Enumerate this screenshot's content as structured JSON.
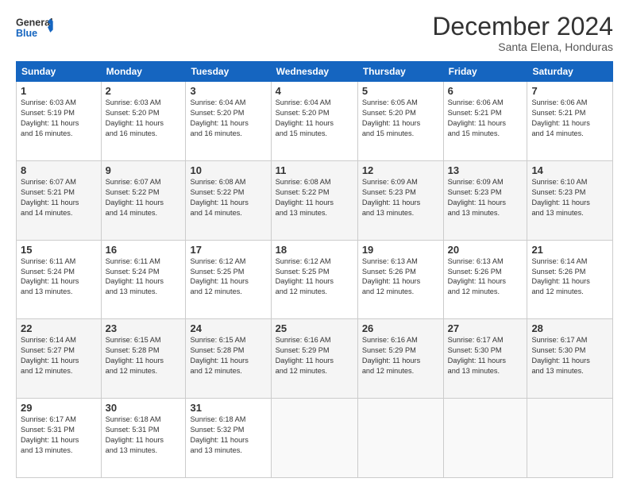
{
  "logo": {
    "line1": "General",
    "line2": "Blue"
  },
  "header": {
    "month_year": "December 2024",
    "location": "Santa Elena, Honduras"
  },
  "weekdays": [
    "Sunday",
    "Monday",
    "Tuesday",
    "Wednesday",
    "Thursday",
    "Friday",
    "Saturday"
  ],
  "weeks": [
    [
      {
        "day": "1",
        "sunrise": "6:03 AM",
        "sunset": "5:19 PM",
        "daylight": "11 hours and 16 minutes."
      },
      {
        "day": "2",
        "sunrise": "6:03 AM",
        "sunset": "5:20 PM",
        "daylight": "11 hours and 16 minutes."
      },
      {
        "day": "3",
        "sunrise": "6:04 AM",
        "sunset": "5:20 PM",
        "daylight": "11 hours and 16 minutes."
      },
      {
        "day": "4",
        "sunrise": "6:04 AM",
        "sunset": "5:20 PM",
        "daylight": "11 hours and 15 minutes."
      },
      {
        "day": "5",
        "sunrise": "6:05 AM",
        "sunset": "5:20 PM",
        "daylight": "11 hours and 15 minutes."
      },
      {
        "day": "6",
        "sunrise": "6:06 AM",
        "sunset": "5:21 PM",
        "daylight": "11 hours and 15 minutes."
      },
      {
        "day": "7",
        "sunrise": "6:06 AM",
        "sunset": "5:21 PM",
        "daylight": "11 hours and 14 minutes."
      }
    ],
    [
      {
        "day": "8",
        "sunrise": "6:07 AM",
        "sunset": "5:21 PM",
        "daylight": "11 hours and 14 minutes."
      },
      {
        "day": "9",
        "sunrise": "6:07 AM",
        "sunset": "5:22 PM",
        "daylight": "11 hours and 14 minutes."
      },
      {
        "day": "10",
        "sunrise": "6:08 AM",
        "sunset": "5:22 PM",
        "daylight": "11 hours and 14 minutes."
      },
      {
        "day": "11",
        "sunrise": "6:08 AM",
        "sunset": "5:22 PM",
        "daylight": "11 hours and 13 minutes."
      },
      {
        "day": "12",
        "sunrise": "6:09 AM",
        "sunset": "5:23 PM",
        "daylight": "11 hours and 13 minutes."
      },
      {
        "day": "13",
        "sunrise": "6:09 AM",
        "sunset": "5:23 PM",
        "daylight": "11 hours and 13 minutes."
      },
      {
        "day": "14",
        "sunrise": "6:10 AM",
        "sunset": "5:23 PM",
        "daylight": "11 hours and 13 minutes."
      }
    ],
    [
      {
        "day": "15",
        "sunrise": "6:11 AM",
        "sunset": "5:24 PM",
        "daylight": "11 hours and 13 minutes."
      },
      {
        "day": "16",
        "sunrise": "6:11 AM",
        "sunset": "5:24 PM",
        "daylight": "11 hours and 13 minutes."
      },
      {
        "day": "17",
        "sunrise": "6:12 AM",
        "sunset": "5:25 PM",
        "daylight": "11 hours and 12 minutes."
      },
      {
        "day": "18",
        "sunrise": "6:12 AM",
        "sunset": "5:25 PM",
        "daylight": "11 hours and 12 minutes."
      },
      {
        "day": "19",
        "sunrise": "6:13 AM",
        "sunset": "5:26 PM",
        "daylight": "11 hours and 12 minutes."
      },
      {
        "day": "20",
        "sunrise": "6:13 AM",
        "sunset": "5:26 PM",
        "daylight": "11 hours and 12 minutes."
      },
      {
        "day": "21",
        "sunrise": "6:14 AM",
        "sunset": "5:26 PM",
        "daylight": "11 hours and 12 minutes."
      }
    ],
    [
      {
        "day": "22",
        "sunrise": "6:14 AM",
        "sunset": "5:27 PM",
        "daylight": "11 hours and 12 minutes."
      },
      {
        "day": "23",
        "sunrise": "6:15 AM",
        "sunset": "5:28 PM",
        "daylight": "11 hours and 12 minutes."
      },
      {
        "day": "24",
        "sunrise": "6:15 AM",
        "sunset": "5:28 PM",
        "daylight": "11 hours and 12 minutes."
      },
      {
        "day": "25",
        "sunrise": "6:16 AM",
        "sunset": "5:29 PM",
        "daylight": "11 hours and 12 minutes."
      },
      {
        "day": "26",
        "sunrise": "6:16 AM",
        "sunset": "5:29 PM",
        "daylight": "11 hours and 12 minutes."
      },
      {
        "day": "27",
        "sunrise": "6:17 AM",
        "sunset": "5:30 PM",
        "daylight": "11 hours and 13 minutes."
      },
      {
        "day": "28",
        "sunrise": "6:17 AM",
        "sunset": "5:30 PM",
        "daylight": "11 hours and 13 minutes."
      }
    ],
    [
      {
        "day": "29",
        "sunrise": "6:17 AM",
        "sunset": "5:31 PM",
        "daylight": "11 hours and 13 minutes."
      },
      {
        "day": "30",
        "sunrise": "6:18 AM",
        "sunset": "5:31 PM",
        "daylight": "11 hours and 13 minutes."
      },
      {
        "day": "31",
        "sunrise": "6:18 AM",
        "sunset": "5:32 PM",
        "daylight": "11 hours and 13 minutes."
      },
      null,
      null,
      null,
      null
    ]
  ]
}
